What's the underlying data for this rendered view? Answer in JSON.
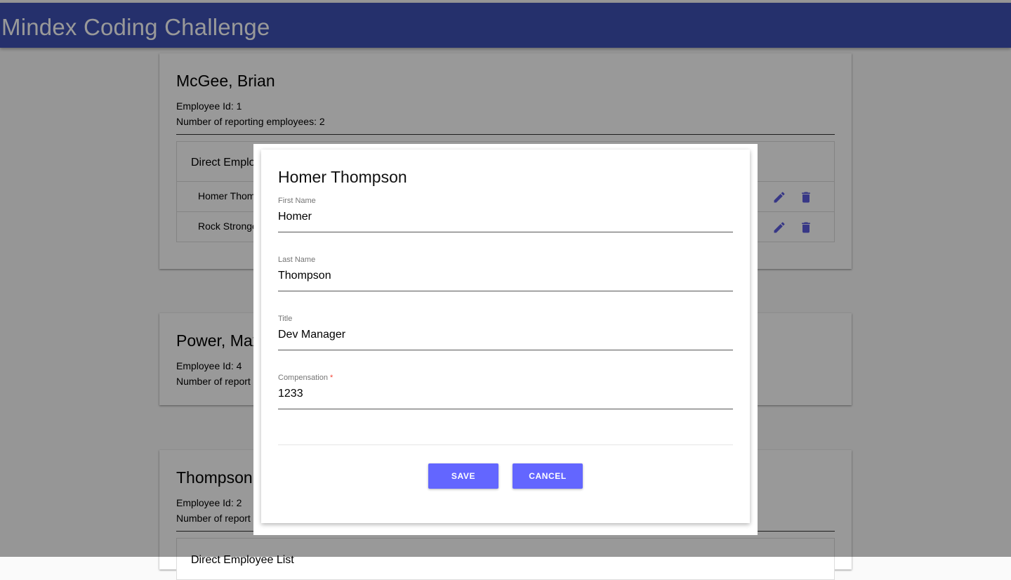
{
  "app": {
    "title": "Mindex Coding Challenge"
  },
  "colors": {
    "toolbar": "#3f51b5",
    "accent_icon": "#5c5ce0",
    "button": "#6366ff",
    "required": "#f44336"
  },
  "employees": [
    {
      "name": "McGee, Brian",
      "id_line": "Employee Id: 1",
      "reports_line": "Number of reporting employees: 2",
      "direct_heading": "Direct Emplo",
      "reports": [
        {
          "name": "Homer Thom",
          "edit_icon": "pencil-icon",
          "delete_icon": "trash-icon"
        },
        {
          "name": "Rock Stronge",
          "edit_icon": "pencil-icon",
          "delete_icon": "trash-icon"
        }
      ]
    },
    {
      "name": "Power, Max",
      "id_line": "Employee Id: 4",
      "reports_line": "Number of report"
    },
    {
      "name": "Thompson",
      "id_line": "Employee Id: 2",
      "reports_line": "Number of report",
      "direct_heading": "Direct Employee List"
    }
  ],
  "dialog": {
    "title": "Homer Thompson",
    "fields": [
      {
        "label": "First Name",
        "value": "Homer",
        "required": false
      },
      {
        "label": "Last Name",
        "value": "Thompson",
        "required": false
      },
      {
        "label": "Title",
        "value": "Dev Manager",
        "required": false
      },
      {
        "label": "Compensation",
        "value": "1233",
        "required": true,
        "required_mark": "*"
      }
    ],
    "save_label": "SAVE",
    "cancel_label": "CANCEL"
  }
}
